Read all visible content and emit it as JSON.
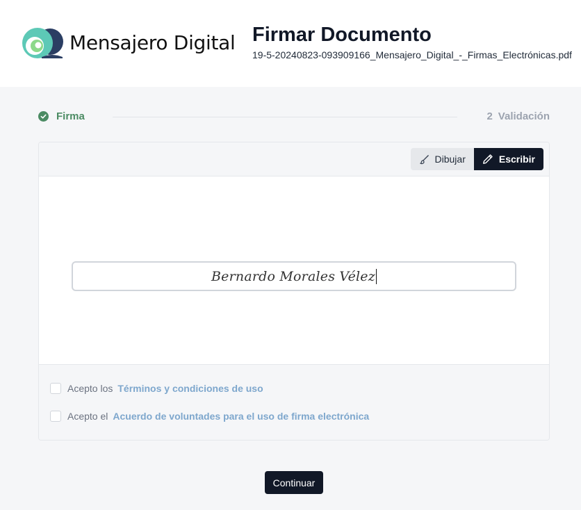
{
  "brand": {
    "name": "Mensajero Digital",
    "logo_icon": "wave-swirl-logo",
    "colors": {
      "teal": "#5dc9b6",
      "navy": "#2b3e63",
      "green": "#8dd98a"
    }
  },
  "header": {
    "title": "Firmar Documento",
    "filename": "19-5-20240823-093909166_Mensajero_Digital_-_Firmas_Electrónicas.pdf"
  },
  "steps": [
    {
      "number": "",
      "label": "Firma",
      "status": "complete",
      "icon": "check-circle-icon",
      "color": "#4b8b63"
    },
    {
      "number": "2",
      "label": "Validación",
      "status": "pending",
      "color": "#9ca3af"
    }
  ],
  "signature_modes": {
    "draw_label": "Dibujar",
    "draw_icon": "brush-icon",
    "write_label": "Escribir",
    "write_icon": "pencil-icon",
    "active": "Escribir"
  },
  "signature": {
    "value": "Bernardo Morales Vélez"
  },
  "agreements": [
    {
      "prefix": "Acepto los",
      "link": "Términos y condiciones de uso",
      "checked": false
    },
    {
      "prefix": "Acepto el",
      "link": "Acuerdo de voluntades para el uso de firma electrónica",
      "checked": false
    }
  ],
  "continue_label": "Continuar"
}
